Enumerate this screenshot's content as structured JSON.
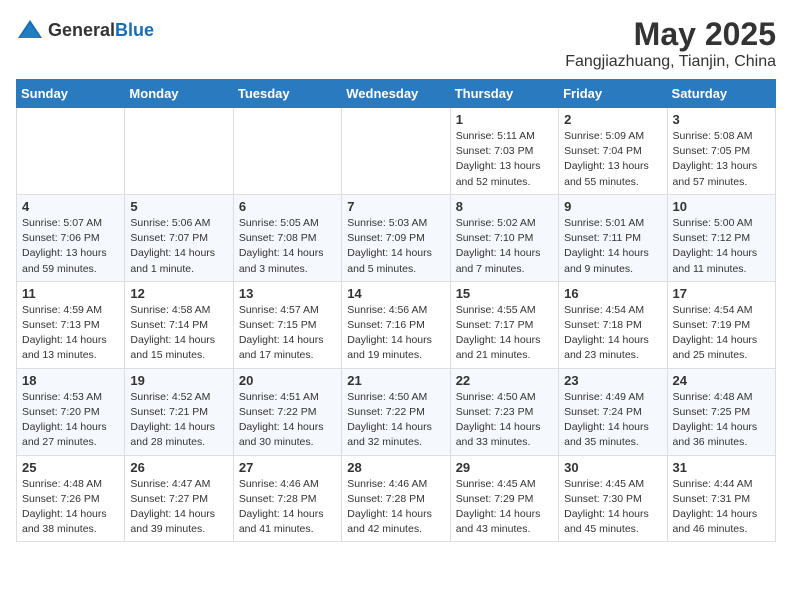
{
  "header": {
    "logo_general": "General",
    "logo_blue": "Blue",
    "month_title": "May 2025",
    "location": "Fangjiazhuang, Tianjin, China"
  },
  "days_of_week": [
    "Sunday",
    "Monday",
    "Tuesday",
    "Wednesday",
    "Thursday",
    "Friday",
    "Saturday"
  ],
  "weeks": [
    [
      null,
      null,
      null,
      null,
      {
        "day": 1,
        "sunrise": "5:11 AM",
        "sunset": "7:03 PM",
        "daylight": "13 hours and 52 minutes."
      },
      {
        "day": 2,
        "sunrise": "5:09 AM",
        "sunset": "7:04 PM",
        "daylight": "13 hours and 55 minutes."
      },
      {
        "day": 3,
        "sunrise": "5:08 AM",
        "sunset": "7:05 PM",
        "daylight": "13 hours and 57 minutes."
      }
    ],
    [
      {
        "day": 4,
        "sunrise": "5:07 AM",
        "sunset": "7:06 PM",
        "daylight": "13 hours and 59 minutes."
      },
      {
        "day": 5,
        "sunrise": "5:06 AM",
        "sunset": "7:07 PM",
        "daylight": "14 hours and 1 minute."
      },
      {
        "day": 6,
        "sunrise": "5:05 AM",
        "sunset": "7:08 PM",
        "daylight": "14 hours and 3 minutes."
      },
      {
        "day": 7,
        "sunrise": "5:03 AM",
        "sunset": "7:09 PM",
        "daylight": "14 hours and 5 minutes."
      },
      {
        "day": 8,
        "sunrise": "5:02 AM",
        "sunset": "7:10 PM",
        "daylight": "14 hours and 7 minutes."
      },
      {
        "day": 9,
        "sunrise": "5:01 AM",
        "sunset": "7:11 PM",
        "daylight": "14 hours and 9 minutes."
      },
      {
        "day": 10,
        "sunrise": "5:00 AM",
        "sunset": "7:12 PM",
        "daylight": "14 hours and 11 minutes."
      }
    ],
    [
      {
        "day": 11,
        "sunrise": "4:59 AM",
        "sunset": "7:13 PM",
        "daylight": "14 hours and 13 minutes."
      },
      {
        "day": 12,
        "sunrise": "4:58 AM",
        "sunset": "7:14 PM",
        "daylight": "14 hours and 15 minutes."
      },
      {
        "day": 13,
        "sunrise": "4:57 AM",
        "sunset": "7:15 PM",
        "daylight": "14 hours and 17 minutes."
      },
      {
        "day": 14,
        "sunrise": "4:56 AM",
        "sunset": "7:16 PM",
        "daylight": "14 hours and 19 minutes."
      },
      {
        "day": 15,
        "sunrise": "4:55 AM",
        "sunset": "7:17 PM",
        "daylight": "14 hours and 21 minutes."
      },
      {
        "day": 16,
        "sunrise": "4:54 AM",
        "sunset": "7:18 PM",
        "daylight": "14 hours and 23 minutes."
      },
      {
        "day": 17,
        "sunrise": "4:54 AM",
        "sunset": "7:19 PM",
        "daylight": "14 hours and 25 minutes."
      }
    ],
    [
      {
        "day": 18,
        "sunrise": "4:53 AM",
        "sunset": "7:20 PM",
        "daylight": "14 hours and 27 minutes."
      },
      {
        "day": 19,
        "sunrise": "4:52 AM",
        "sunset": "7:21 PM",
        "daylight": "14 hours and 28 minutes."
      },
      {
        "day": 20,
        "sunrise": "4:51 AM",
        "sunset": "7:22 PM",
        "daylight": "14 hours and 30 minutes."
      },
      {
        "day": 21,
        "sunrise": "4:50 AM",
        "sunset": "7:22 PM",
        "daylight": "14 hours and 32 minutes."
      },
      {
        "day": 22,
        "sunrise": "4:50 AM",
        "sunset": "7:23 PM",
        "daylight": "14 hours and 33 minutes."
      },
      {
        "day": 23,
        "sunrise": "4:49 AM",
        "sunset": "7:24 PM",
        "daylight": "14 hours and 35 minutes."
      },
      {
        "day": 24,
        "sunrise": "4:48 AM",
        "sunset": "7:25 PM",
        "daylight": "14 hours and 36 minutes."
      }
    ],
    [
      {
        "day": 25,
        "sunrise": "4:48 AM",
        "sunset": "7:26 PM",
        "daylight": "14 hours and 38 minutes."
      },
      {
        "day": 26,
        "sunrise": "4:47 AM",
        "sunset": "7:27 PM",
        "daylight": "14 hours and 39 minutes."
      },
      {
        "day": 27,
        "sunrise": "4:46 AM",
        "sunset": "7:28 PM",
        "daylight": "14 hours and 41 minutes."
      },
      {
        "day": 28,
        "sunrise": "4:46 AM",
        "sunset": "7:28 PM",
        "daylight": "14 hours and 42 minutes."
      },
      {
        "day": 29,
        "sunrise": "4:45 AM",
        "sunset": "7:29 PM",
        "daylight": "14 hours and 43 minutes."
      },
      {
        "day": 30,
        "sunrise": "4:45 AM",
        "sunset": "7:30 PM",
        "daylight": "14 hours and 45 minutes."
      },
      {
        "day": 31,
        "sunrise": "4:44 AM",
        "sunset": "7:31 PM",
        "daylight": "14 hours and 46 minutes."
      }
    ]
  ],
  "labels": {
    "sunrise": "Sunrise:",
    "sunset": "Sunset:",
    "daylight": "Daylight:"
  }
}
